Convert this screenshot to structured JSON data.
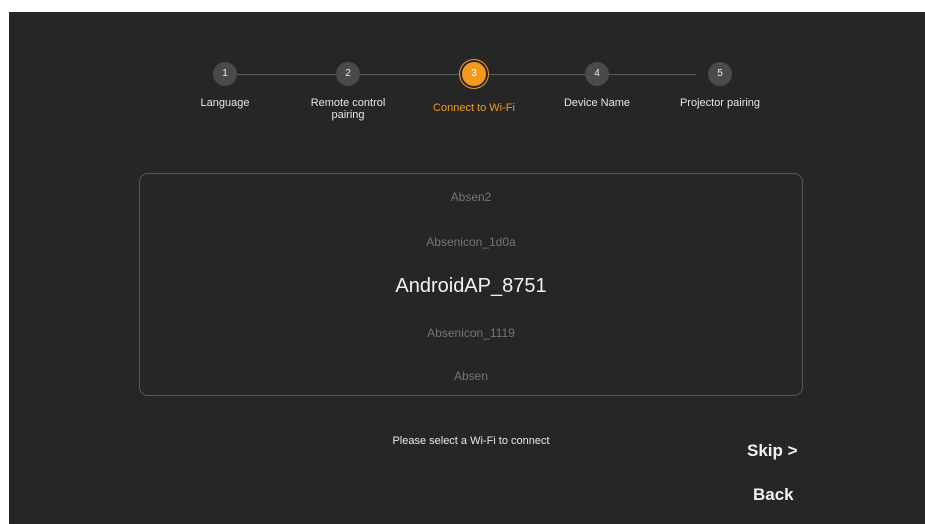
{
  "steps": [
    {
      "number": "1",
      "label": "Language",
      "active": false
    },
    {
      "number": "2",
      "label": "Remote control\npairing",
      "active": false
    },
    {
      "number": "3",
      "label": "Connect to Wi-Fi",
      "active": true
    },
    {
      "number": "4",
      "label": "Device Name",
      "active": false
    },
    {
      "number": "5",
      "label": "Projector pairing",
      "active": false
    }
  ],
  "wifi_list": {
    "networks": [
      "Absen2",
      "Absenicon_1d0a",
      "AndroidAP_8751",
      "Absenicon_1119",
      "Absen"
    ],
    "selected": "AndroidAP_8751"
  },
  "hint": "Please select a Wi-Fi to connect",
  "buttons": {
    "skip": "Skip >",
    "back": "Back"
  },
  "colors": {
    "background": "#262626",
    "accent": "#f39a1e",
    "inactive_step": "#4a4a4a",
    "dim_text": "#757575"
  }
}
